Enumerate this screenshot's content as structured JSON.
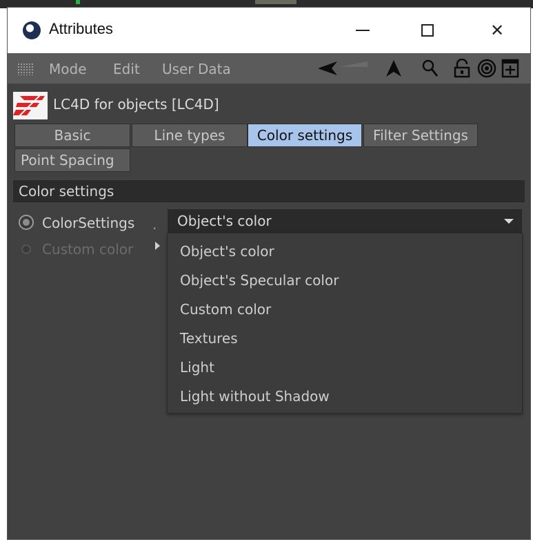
{
  "window": {
    "title": "Attributes",
    "controls": {
      "minimize": "minimize",
      "maximize": "maximize",
      "close": "✕"
    }
  },
  "menu": {
    "items": [
      "Mode",
      "Edit",
      "User Data"
    ]
  },
  "toolbar": {
    "icons": [
      "arrow-left-icon",
      "arrow-up-icon",
      "search-icon",
      "lock-icon",
      "target-icon",
      "new-panel-icon"
    ]
  },
  "object": {
    "title": "LC4D for objects [LC4D]"
  },
  "tabs": {
    "row1": [
      "Basic",
      "Line types",
      "Color settings",
      "Filter Settings"
    ],
    "row2": [
      "Point Spacing"
    ],
    "active": "Color settings",
    "active_color": "#a7c5ea"
  },
  "section": {
    "title": "Color settings"
  },
  "params": {
    "color_settings_label": "ColorSettings",
    "color_settings_dots": ".",
    "color_settings_value": "Object's color",
    "custom_color_label": "Custom color"
  },
  "dropdown": {
    "options": [
      "Object's color",
      "Object's Specular color",
      "Custom color",
      "Textures",
      "Light",
      "Light without Shadow"
    ]
  },
  "colors": {
    "panel_bg": "#414141",
    "menubar_bg": "#5b5b5b",
    "header_bg": "#2b2b2b"
  }
}
